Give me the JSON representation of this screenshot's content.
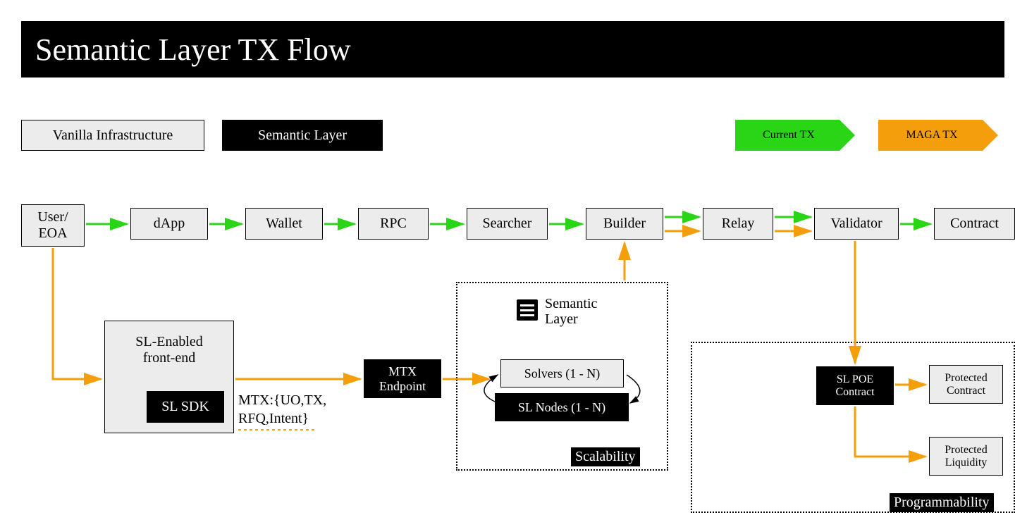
{
  "title": "Semantic Layer TX Flow",
  "legend": {
    "vanilla": "Vanilla Infrastructure",
    "semantic": "Semantic Layer",
    "current_tx": "Current TX",
    "maga_tx": "MAGA TX"
  },
  "colors": {
    "green": "#2ad515",
    "orange": "#f59e0b",
    "light": "#ececec",
    "black": "#000000"
  },
  "top_row": {
    "user_eoa": "User/\nEOA",
    "dapp": "dApp",
    "wallet": "Wallet",
    "rpc": "RPC",
    "searcher": "Searcher",
    "builder": "Builder",
    "relay": "Relay",
    "validator": "Validator",
    "contract": "Contract"
  },
  "sl_frontend": {
    "title_line1": "SL-Enabled",
    "title_line2": "front-end",
    "sdk": "SL SDK"
  },
  "mtx_endpoint": "MTX\nEndpoint",
  "mtx_label_line1": "MTX:{UO,TX,",
  "mtx_label_line2": "RFQ,Intent}",
  "scalability_box": {
    "brand": "Semantic\nLayer",
    "solvers": "Solvers (1 - N)",
    "sl_nodes": "SL Nodes (1 - N)",
    "tag": "Scalability"
  },
  "programmability_box": {
    "sl_poe": "SL POE\nContract",
    "protected_contract": "Protected\nContract",
    "protected_liquidity": "Protected\nLiquidity",
    "tag": "Programmability"
  }
}
